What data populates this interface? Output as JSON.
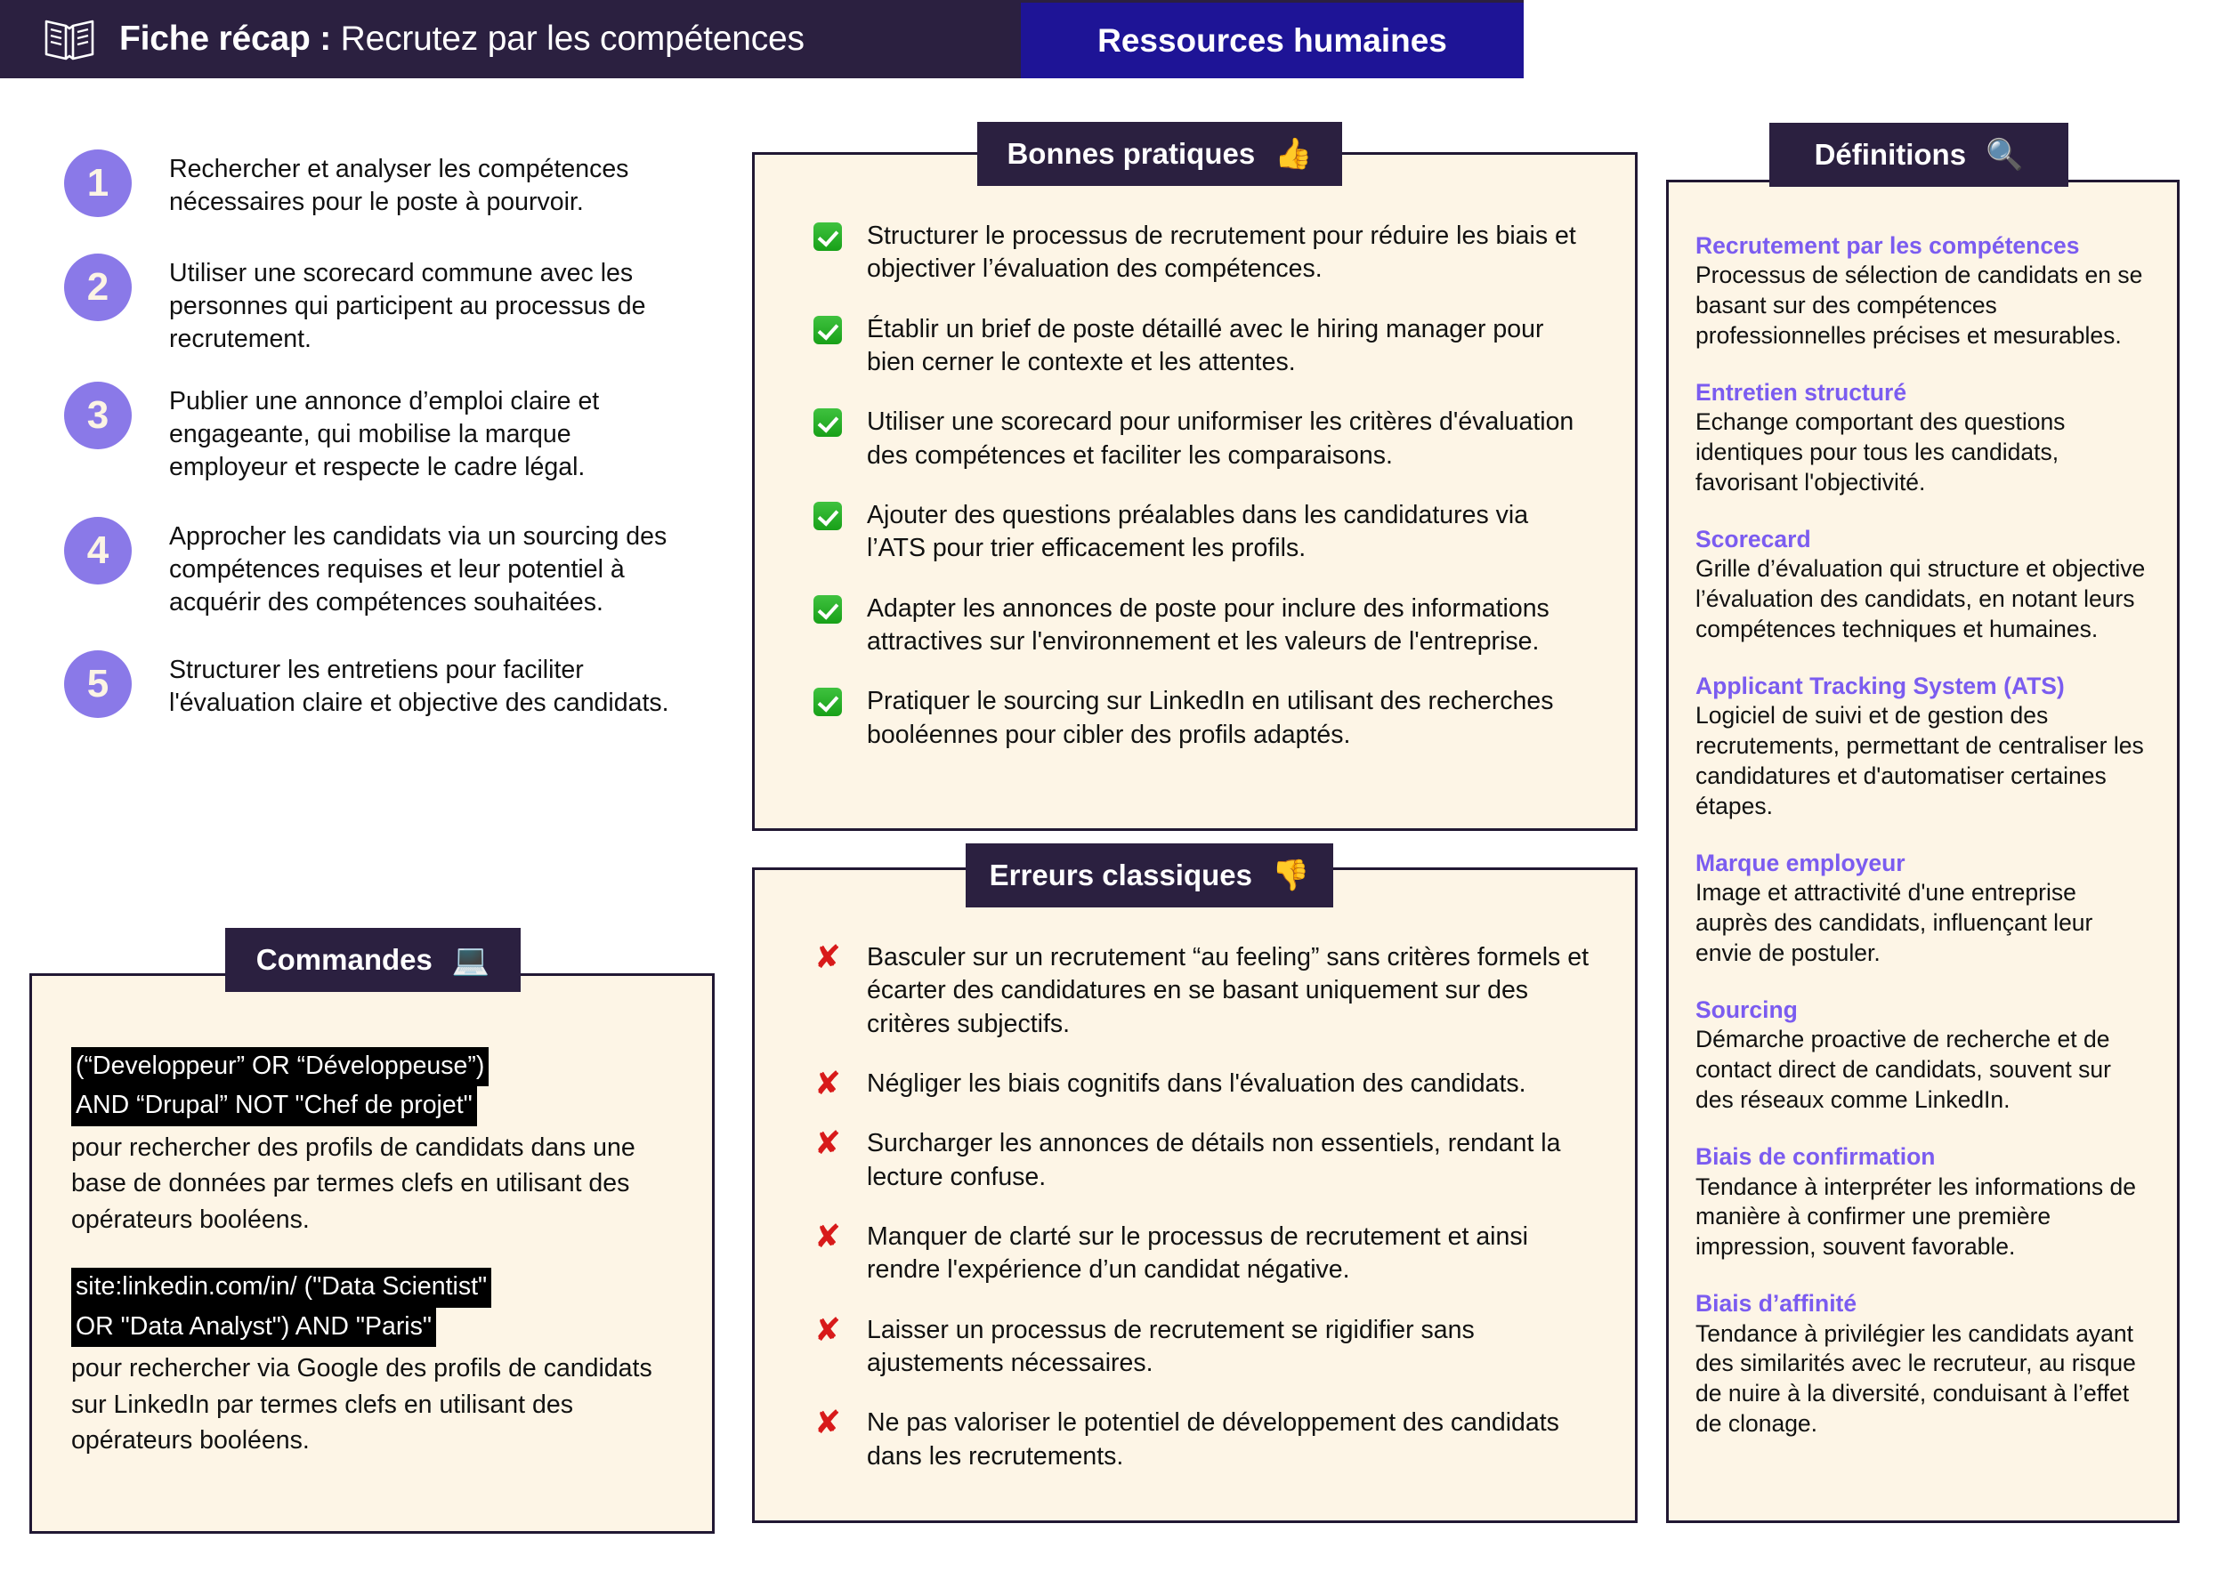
{
  "header": {
    "icon": "open-book-icon",
    "title_strong": "Fiche récap :",
    "title_rest": " Recrutez par les compétences",
    "tag_label": "Ressources humaines",
    "band_color": "#2B2040",
    "tag_color": "#1E1496"
  },
  "steps": {
    "badge_color": "#8A79E8",
    "items": [
      {
        "number": "1",
        "text": "Rechercher et analyser les compétences nécessaires pour le poste à pourvoir."
      },
      {
        "number": "2",
        "text": "Utiliser une scorecard commune avec les personnes qui participent au processus de recrutement."
      },
      {
        "number": "3",
        "text": "Publier une annonce d’emploi claire et engageante, qui mobilise la marque employeur et respecte le cadre légal."
      },
      {
        "number": "4",
        "text": "Approcher les candidats via un sourcing des compétences requises et leur potentiel à acquérir des compétences souhaitées."
      },
      {
        "number": "5",
        "text": "Structurer les entretiens pour faciliter l'évaluation claire et objective des candidats."
      }
    ]
  },
  "commandes": {
    "cap_label": "Commandes",
    "cap_icon": "laptop-icon",
    "cap_emoji": "💻",
    "blocks": [
      {
        "code_lines": [
          "(“Developpeur” OR “Développeuse”)",
          "AND “Drupal” NOT \"Chef de projet\""
        ],
        "description": "pour rechercher des profils de candidats dans une base de données par termes clefs en utilisant des opérateurs booléens."
      },
      {
        "code_lines": [
          " site:linkedin.com/in/ (\"Data Scientist\"",
          "OR \"Data Analyst\") AND \"Paris\""
        ],
        "description": "pour rechercher via Google des profils de candidats sur LinkedIn par termes clefs en utilisant des opérateurs booléens."
      }
    ]
  },
  "bonnes_pratiques": {
    "cap_label": "Bonnes pratiques",
    "cap_icon": "thumbs-up-icon",
    "cap_emoji": "👍",
    "mark_icon": "green-check-icon",
    "items": [
      "Structurer le processus de recrutement pour réduire les biais et objectiver l’évaluation des compétences.",
      "Établir un brief de poste détaillé avec le hiring manager pour bien cerner le contexte et les attentes.",
      "Utiliser une scorecard pour uniformiser les critères d'évaluation des compétences et faciliter les comparaisons.",
      "Ajouter des questions préalables dans les candidatures via l’ATS pour trier efficacement les profils.",
      "Adapter les annonces de poste pour inclure des informations attractives sur l'environnement et les valeurs de l'entreprise.",
      "Pratiquer le sourcing sur LinkedIn en utilisant des recherches booléennes pour cibler des profils adaptés."
    ]
  },
  "erreurs_classiques": {
    "cap_label": "Erreurs classiques",
    "cap_icon": "thumbs-down-icon",
    "cap_emoji": "👎",
    "mark_icon": "red-cross-icon",
    "items": [
      "Basculer sur un recrutement “au feeling” sans critères formels et écarter des candidatures en se basant uniquement sur des critères subjectifs.",
      "Négliger les biais cognitifs dans l'évaluation des candidats.",
      "Surcharger les annonces de détails non essentiels, rendant la lecture confuse.",
      "Manquer de clarté sur le processus de recrutement et ainsi rendre l'expérience d’un candidat négative.",
      "Laisser un processus de recrutement se rigidifier sans ajustements nécessaires.",
      "Ne pas valoriser le potentiel de développement des candidats dans les recrutements."
    ]
  },
  "definitions": {
    "cap_label": "Définitions",
    "cap_icon": "magnifier-icon",
    "cap_emoji": "🔍",
    "term_color": "#7B5CF0",
    "items": [
      {
        "term": "Recrutement par les compétences",
        "description": "Processus de sélection de candidats en se basant sur des compétences professionnelles précises et mesurables."
      },
      {
        "term": "Entretien structuré",
        "description": "Echange comportant des questions identiques pour tous les candidats, favorisant l'objectivité."
      },
      {
        "term": "Scorecard",
        "description": "Grille d’évaluation qui structure et objective l’évaluation des candidats, en notant leurs compétences techniques et humaines."
      },
      {
        "term": "Applicant Tracking System (ATS)",
        "description": "Logiciel de suivi et de gestion des recrutements, permettant de centraliser les candidatures et d'automatiser certaines étapes."
      },
      {
        "term": "Marque employeur",
        "description": "Image et attractivité d'une entreprise auprès des candidats, influençant leur envie de postuler."
      },
      {
        "term": "Sourcing",
        "description": "Démarche proactive de recherche et de contact direct de candidats, souvent sur des réseaux comme LinkedIn."
      },
      {
        "term": "Biais de confirmation",
        "description": "Tendance à interpréter les informations de manière à confirmer une première impression, souvent favorable."
      },
      {
        "term": "Biais d’affinité",
        "description": "Tendance à privilégier les candidats ayant des similarités avec le recruteur, au risque de nuire à la diversité, conduisant à l’effet de clonage."
      }
    ]
  }
}
